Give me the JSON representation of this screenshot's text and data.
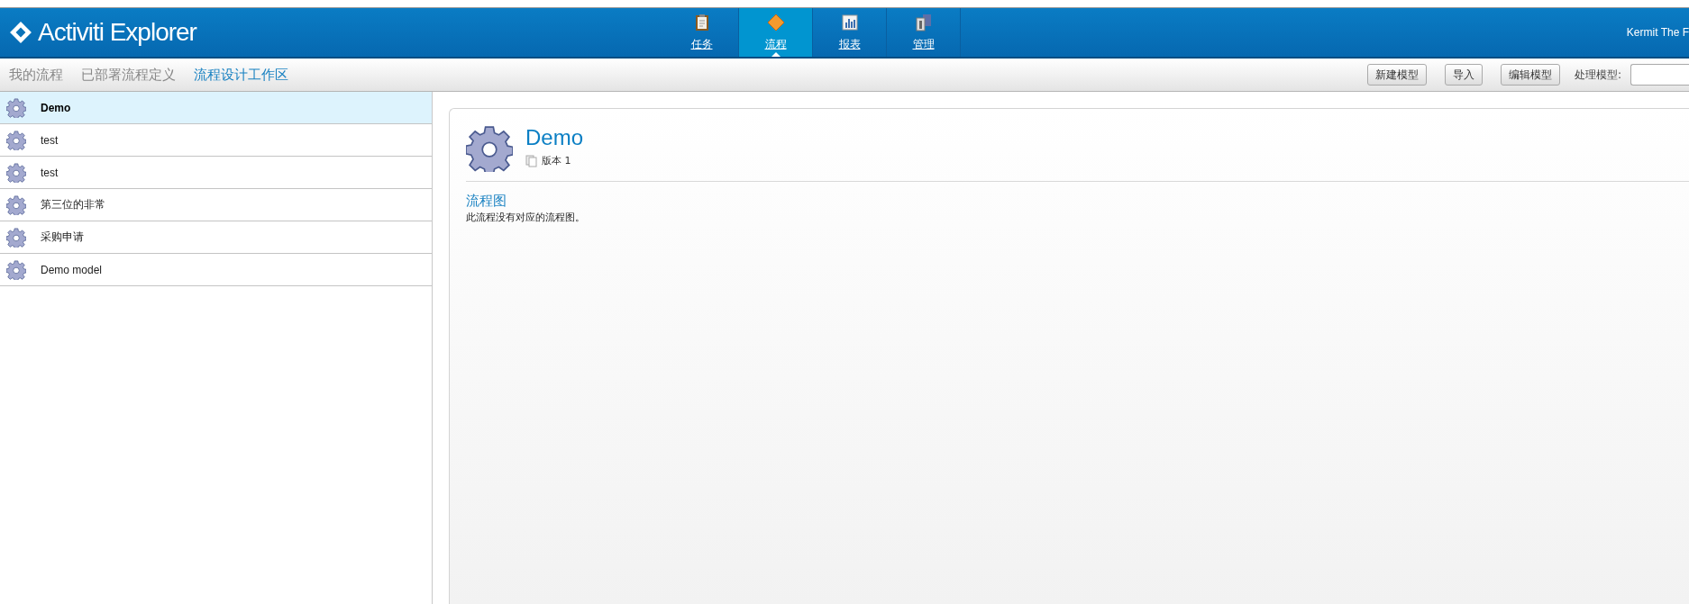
{
  "header": {
    "logo": "Activiti Explorer",
    "user": "Kermit The F"
  },
  "nav": [
    {
      "label": "任务",
      "selected": false
    },
    {
      "label": "流程",
      "selected": true
    },
    {
      "label": "报表",
      "selected": false
    },
    {
      "label": "管理",
      "selected": false
    }
  ],
  "subnav": [
    {
      "label": "我的流程",
      "selected": false
    },
    {
      "label": "已部署流程定义",
      "selected": false
    },
    {
      "label": "流程设计工作区",
      "selected": true
    }
  ],
  "toolbar": {
    "buttons": [
      "新建模型",
      "导入",
      "编辑模型"
    ],
    "field_label": "处理模型:"
  },
  "models": [
    {
      "name": "Demo",
      "selected": true
    },
    {
      "name": "test",
      "selected": false
    },
    {
      "name": "test",
      "selected": false
    },
    {
      "name": "第三位的非常",
      "selected": false
    },
    {
      "name": "采购申请",
      "selected": false
    },
    {
      "name": "Demo model",
      "selected": false
    }
  ],
  "detail": {
    "title": "Demo",
    "version": "版本 1",
    "section": "流程图",
    "message": "此流程没有对应的流程图。"
  }
}
